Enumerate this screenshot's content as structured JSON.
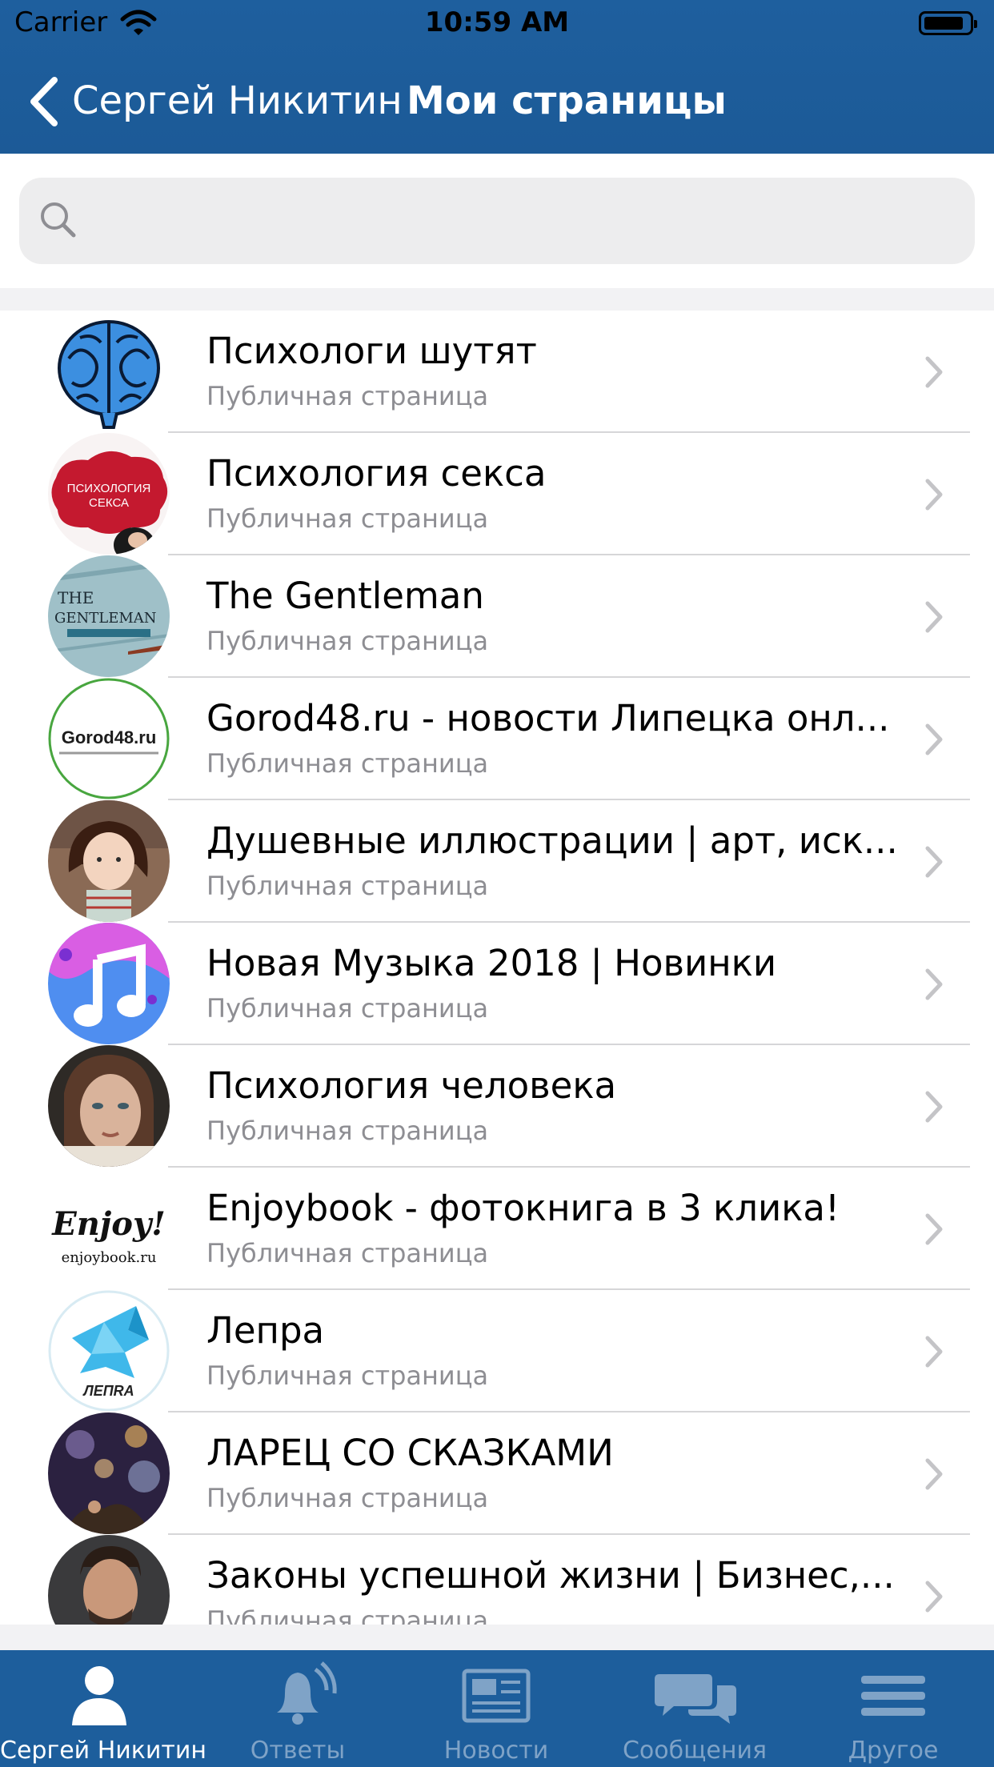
{
  "status_bar": {
    "carrier": "Carrier",
    "time": "10:59 AM"
  },
  "nav": {
    "back_label": "Сергей Никитин",
    "title": "Мои страницы"
  },
  "search": {
    "placeholder": ""
  },
  "rows": [
    {
      "title": "Психологи шутят",
      "subtitle": "Публичная страница",
      "avatar": "brain-icon"
    },
    {
      "title": "Психология секса",
      "subtitle": "Публичная страница",
      "avatar": "psychology-sex-logo",
      "avatar_text": [
        "ПСИХОЛОГИЯ",
        "СЕКСА"
      ]
    },
    {
      "title": "The Gentleman",
      "subtitle": "Публичная страница",
      "avatar": "gentleman-logo",
      "avatar_text": [
        "THE",
        "GENTLEMAN"
      ]
    },
    {
      "title": "Gorod48.ru - новости Липецка онл...",
      "subtitle": "Публичная страница",
      "avatar": "gorod48-logo",
      "avatar_text": [
        "Gorod48.ru"
      ]
    },
    {
      "title": "Душевные иллюстрации | арт, иск...",
      "subtitle": "Публичная страница",
      "avatar": "girl-illustration"
    },
    {
      "title": "Новая Музыка 2018 | Новинки",
      "subtitle": "Публичная страница",
      "avatar": "music-note-icon"
    },
    {
      "title": "Психология человека",
      "subtitle": "Публичная страница",
      "avatar": "woman-portrait"
    },
    {
      "title": "Enjoybook - фотокнига в 3 клика!",
      "subtitle": "Публичная страница",
      "avatar": "enjoybook-logo",
      "avatar_text": [
        "Enjoy!",
        "enjoybook.ru"
      ]
    },
    {
      "title": "Лепра",
      "subtitle": "Публичная страница",
      "avatar": "lepra-logo",
      "avatar_text": [
        "ЛЕПRA"
      ]
    },
    {
      "title": "ЛАРЕЦ СО СКАЗКАМИ",
      "subtitle": "Публичная страница",
      "avatar": "fairy-tale-image"
    },
    {
      "title": "Законы успешной жизни | Бизнес,...",
      "subtitle": "Публичная страница",
      "avatar": "businessman-portrait"
    }
  ],
  "tabs": [
    {
      "label": "Сергей Никитин",
      "icon": "person-icon",
      "active": true
    },
    {
      "label": "Ответы",
      "icon": "bell-icon",
      "active": false
    },
    {
      "label": "Новости",
      "icon": "newspaper-icon",
      "active": false
    },
    {
      "label": "Сообщения",
      "icon": "chat-bubbles-icon",
      "active": false
    },
    {
      "label": "Другое",
      "icon": "menu-icon",
      "active": false
    }
  ],
  "colors": {
    "bar": "#1d5e9c",
    "tab_active": "#ffffff",
    "tab_inactive": "#7fa3c7"
  }
}
